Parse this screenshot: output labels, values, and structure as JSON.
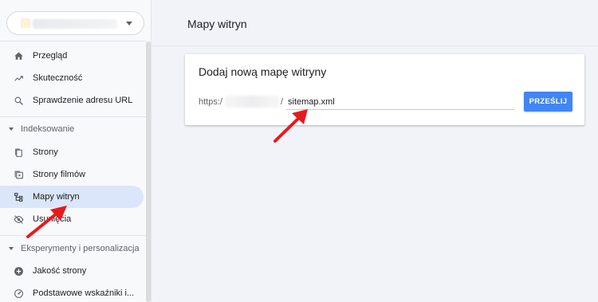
{
  "sidebar": {
    "items": [
      {
        "label": "Przegląd",
        "icon": "home-icon"
      },
      {
        "label": "Skuteczność",
        "icon": "trending-up-icon"
      },
      {
        "label": "Sprawdzenie adresu URL",
        "icon": "search-icon"
      },
      {
        "label": "Strony",
        "icon": "pages-icon"
      },
      {
        "label": "Strony filmów",
        "icon": "video-pages-icon"
      },
      {
        "label": "Mapy witryn",
        "icon": "sitemap-icon",
        "active": true
      },
      {
        "label": "Usunięcia",
        "icon": "visibility-off-icon"
      },
      {
        "label": "Jakość strony",
        "icon": "add-circle-icon"
      },
      {
        "label": "Podstawowe wskaźniki i...",
        "icon": "speed-gauge-icon"
      }
    ],
    "sections": {
      "indexing": "Indeksowanie",
      "experiments": "Eksperymenty i personalizacja"
    }
  },
  "header": {
    "title": "Mapy witryn"
  },
  "add_sitemap": {
    "title": "Dodaj nową mapę witryny",
    "url_prefix": "https:/",
    "url_slash": "/",
    "input_value": "sitemap.xml",
    "submit_label": "PRZEŚLIJ"
  },
  "colors": {
    "accent": "#4285f4",
    "active_nav": "#dbe6fb",
    "annotation_arrow": "#e8191c"
  }
}
